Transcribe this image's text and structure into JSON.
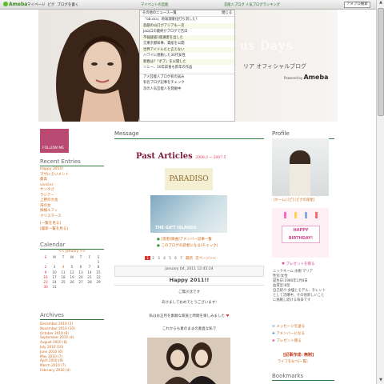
{
  "topbar": {
    "logo": "Ameba",
    "links": [
      "マイページ",
      "ピグ",
      "ブログを書く"
    ],
    "news_header": "芸能人ブログ 人気ブログランキング",
    "news_link": "マイベントの芸能",
    "toolbar": [
      "アメブロ検索"
    ]
  },
  "header": {
    "title": "us Days",
    "subtitle": "リア オフィシャルブログ",
    "powered": "Powered by",
    "brand": "Ameba"
  },
  "news": {
    "header": "その他のニュース一覧",
    "close": "閉じる",
    "items": [
      "『ob.ocs』地球温暖化打ち消した?",
      "悲劇の山口がアジアも一次",
      "Ja山口の最終がブログで告白",
      "不倫疑惑1億損害を出した",
      "元東京都知事、資産を公開",
      "世界アイドルだと言えない",
      "ハワイに感動した30代女性",
      "新春は?『ボブ』を公開した",
      "ソニー、10年前後も新年の作品"
    ],
    "items2": [
      "アメ芸能人ブログ初の試み",
      "有名ブログ記事をチェック",
      "次の人気芸能人を発掘中"
    ]
  },
  "left": {
    "follow_me": "FOLLOW ME",
    "recent_title": "Recent Entries",
    "recent": [
      "Happy 2011!",
      "マザにえいメント",
      "最高",
      "vivid.kr",
      "サンタさ",
      "ラジアー",
      "上野の大会",
      "海の女",
      "探検ルフィ",
      "クリスマース"
    ],
    "recent_more": "[一覧を見る]",
    "recent_more2": "[最新一覧を見る]",
    "calendar_title": "Calendar",
    "calendar_month": "<< January >>",
    "calendar_days": [
      "S",
      "M",
      "T",
      "W",
      "T",
      "F",
      "S"
    ],
    "calendar_rows": [
      [
        "",
        "",
        "",
        "",
        "",
        "",
        "1"
      ],
      [
        "2",
        "3",
        "4",
        "5",
        "6",
        "7",
        "8"
      ],
      [
        "9",
        "10",
        "11",
        "12",
        "13",
        "14",
        "15"
      ],
      [
        "16",
        "17",
        "18",
        "19",
        "20",
        "21",
        "22"
      ],
      [
        "23",
        "24",
        "25",
        "26",
        "27",
        "28",
        "29"
      ],
      [
        "30",
        "31",
        "",
        "",
        "",
        "",
        ""
      ]
    ],
    "archives_title": "Archives",
    "archives": [
      "December 2010 (3)",
      "November 2010 (10)",
      "October 2010 (8)",
      "September 2010 (4)",
      "August 2010 (8)",
      "July 2010 (10)",
      "June 2010 (6)",
      "May 2010 (7)",
      "April 2010 (8)",
      "March 2010 (7)",
      "February 2010 (4)"
    ]
  },
  "main": {
    "section_title": "Message",
    "past_title": "Past Articles",
    "past_dates": "2008.3 ~ 2007.5",
    "banner1": "PARADISO",
    "banner2": "THE GIFT ISLANDS",
    "link1": "[恩恵]楽曲]アメンバー記事一覧",
    "link2": "このブログの読者になる(チェック)",
    "pages": [
      "1",
      "2",
      "3",
      "4",
      "5",
      "6",
      "7"
    ],
    "page_next": "最新",
    "page_all": "次ページ>>",
    "entry_date": "January 04, 2011 12:45:24",
    "entry_title": "Happy 2011!!",
    "body1": "ご無沙汰です",
    "body2": "あけましておめでとうございます!",
    "body3": "私はお正月を素敵な家族と時間を楽しみました",
    "body4": "これからも素のままの素直な私で"
  },
  "right": {
    "profile_title": "Profile",
    "profile_links": "[ホーム] [ピ] [ピグの部屋]",
    "happy": "HAPPY",
    "birthday": "BIRTHDAY!",
    "present": "プレゼントを贈る",
    "info": [
      "ニックネーム:水樹 マリア",
      "性別:女性",
      "誕生日:1986年1月8日",
      "血液型:B型",
      "自己紹介:女優とモデル、タレント",
      "として活躍中。その他新しいこと",
      "に挑戦し続ける毎日です"
    ],
    "btn1": "メッセージを送る",
    "btn2": "アメンバーになる",
    "btn3": "プレゼント贈る",
    "fanclub": "[記事作成: 無制]",
    "fan2": "ライフをもつ[一覧]",
    "bookmarks_title": "Bookmarks"
  }
}
